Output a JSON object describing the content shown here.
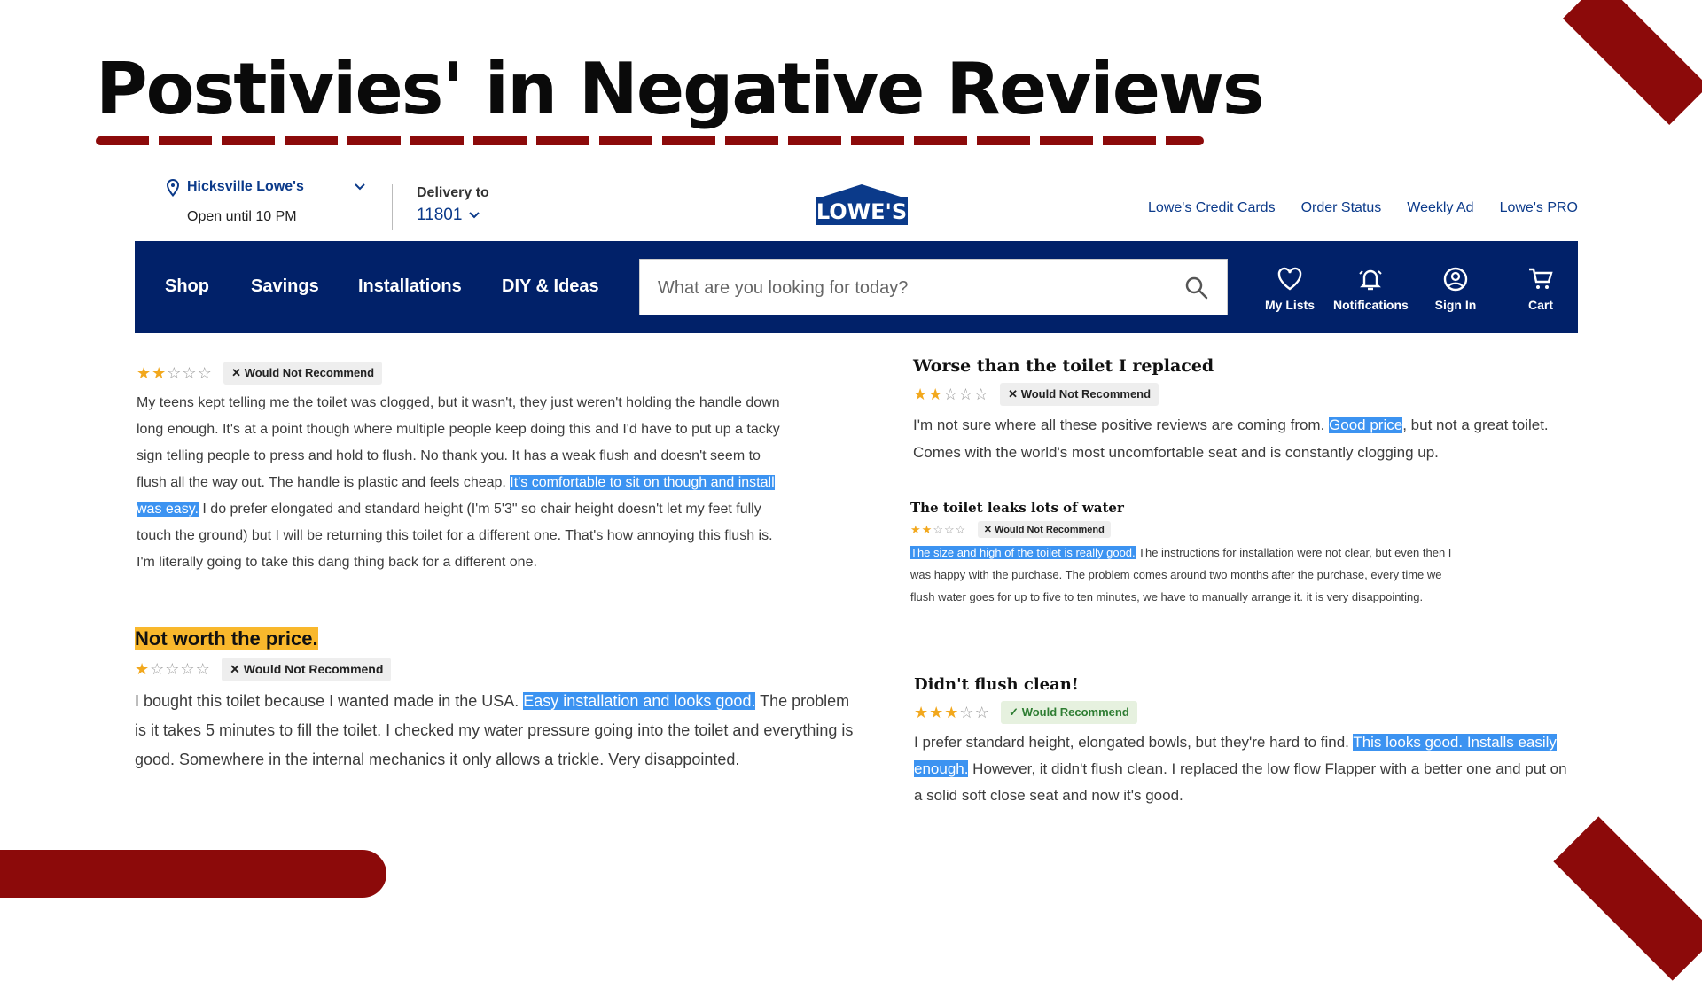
{
  "slide": {
    "title": "Postivies' in Negative Reviews"
  },
  "store": {
    "name": "Hicksville Lowe's",
    "hours": "Open until 10 PM",
    "delivery_label": "Delivery to",
    "zip": "11801",
    "logo_text": "LOWE'S",
    "links": [
      "Lowe's Credit Cards",
      "Order Status",
      "Weekly Ad",
      "Lowe's PRO"
    ]
  },
  "nav": {
    "items": [
      "Shop",
      "Savings",
      "Installations",
      "DIY & Ideas"
    ],
    "search_placeholder": "What are you looking for today?",
    "icons": [
      {
        "label": "My Lists",
        "icon": "heart-icon"
      },
      {
        "label": "Notifications",
        "icon": "bell-icon"
      },
      {
        "label": "Sign In",
        "icon": "user-icon"
      },
      {
        "label": "Cart",
        "icon": "cart-icon"
      }
    ]
  },
  "colors": {
    "accent": "#8c0a0a",
    "navy": "#012169",
    "highlight": "#3c93f1",
    "star": "#f2a81d",
    "title_highlight": "#f9b82c"
  },
  "reviews": [
    {
      "title": "",
      "rating": 2,
      "recommend": "Would Not Recommend",
      "body_before": "My teens kept telling me the toilet was clogged, but it wasn't, they just weren't holding the handle down long enough. It's at a point though where multiple people keep doing this and I'd have to put up a tacky sign telling people to press and hold to flush. No thank you. It has a weak flush and doesn't seem to flush all the way out. The handle is plastic and feels cheap. ",
      "highlight": "It's comfortable to sit on though and install was easy.",
      "body_after": " I do prefer elongated and standard height (I'm 5'3\" so chair height doesn't let my feet fully touch the ground) but I will be returning this toilet for a different one. That's how annoying this flush is. I'm literally going to take this dang thing back for a different one."
    },
    {
      "title": "Not worth the price.",
      "rating": 1,
      "recommend": "Would Not Recommend",
      "body_before": "I bought this toilet because I wanted made in the USA. ",
      "highlight": "Easy installation and looks good.",
      "body_after": " The problem is it takes 5 minutes to fill the toilet. I checked my water pressure going into the toilet and everything is good. Somewhere in the internal mechanics it only allows a trickle. Very disappointed."
    },
    {
      "title": "Worse than the toilet I replaced",
      "rating": 2,
      "recommend": "Would Not Recommend",
      "body_before": "I'm not sure where all these positive reviews are coming from. ",
      "highlight": "Good price",
      "body_after": ", but not a great toilet. Comes with the world's most uncomfortable seat and is constantly clogging up."
    },
    {
      "title": "The toilet leaks lots of water",
      "rating": 2,
      "recommend": "Would Not Recommend",
      "body_before": "",
      "highlight": "The size and high of the toilet is really good.",
      "body_after": " The instructions for installation were not clear, but even then I was happy with the purchase. The problem comes around two months after the purchase, every time we flush water goes for up to five to ten minutes, we have to manually arrange it. it is very disappointing."
    },
    {
      "title": "Didn't flush clean!",
      "rating": 3,
      "recommend": "Would Recommend",
      "body_before": "I prefer standard height, elongated bowls, but they're hard to find. ",
      "highlight": "This looks good. Installs easily enough.",
      "body_after": " However, it didn't flush clean. I replaced the low flow Flapper with a better one and put on a solid soft close seat and now it's good."
    }
  ]
}
